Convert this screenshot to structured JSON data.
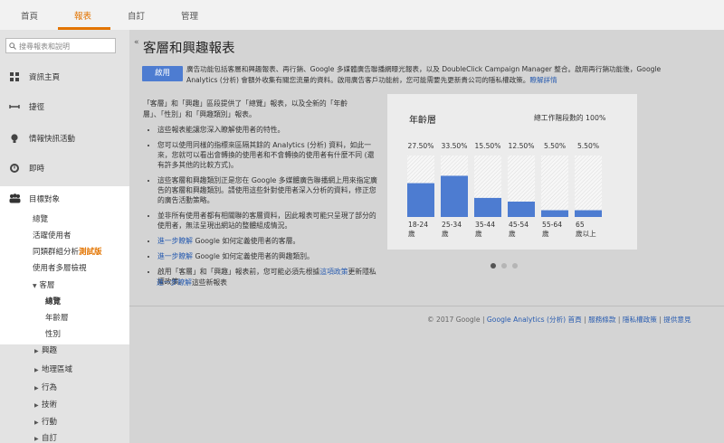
{
  "topnav": {
    "tabs": [
      {
        "label": "首頁"
      },
      {
        "label": "報表"
      },
      {
        "label": "自訂"
      },
      {
        "label": "管理"
      }
    ]
  },
  "sidebar": {
    "search_placeholder": "搜尋報表和說明",
    "items": [
      {
        "label": "資訊主頁"
      },
      {
        "label": "捷徑"
      },
      {
        "label": "情報快訊活動"
      },
      {
        "label": "即時"
      },
      {
        "label": "目標對象"
      }
    ],
    "audience_sub": [
      {
        "label": "總覽"
      },
      {
        "label": "活躍使用者"
      },
      {
        "label": "同類群組分析"
      },
      {
        "label": "使用者多層檢視"
      }
    ],
    "beta": "測試版",
    "demographics": {
      "label": "客層",
      "children": [
        {
          "label": "總覽"
        },
        {
          "label": "年齡層"
        },
        {
          "label": "性別"
        }
      ]
    },
    "tree": [
      {
        "label": "興趣"
      },
      {
        "label": "地理區域"
      },
      {
        "label": "行為"
      },
      {
        "label": "技術"
      },
      {
        "label": "行動"
      },
      {
        "label": "自訂"
      }
    ]
  },
  "main": {
    "title": "客層和興趣報表",
    "enable_button": "啟用",
    "enable_desc": "廣告功能包括客層和興趣報表、再行銷、Google 多媒體廣告聯播網曝光報表，以及 DoubleClick Campaign Manager 整合。啟用再行銷功能後，Google Analytics (分析) 會額外收集有關您流量的資料。啟用廣告客戶功能前，您可能需要先更新貴公司的隱私權政策。",
    "enable_link": "瞭解詳情",
    "intro": "「客層」和「興趣」區段提供了「總覽」報表，以及全新的「年齡層」、「性別」和「興趣類別」報表。",
    "bullets": [
      "這些報表能讓您深入瞭解使用者的特性。",
      "您可以使用同樣的指標來區隔其餘的 Analytics (分析) 資料，如此一來，您就可以看出會轉換的使用者和不會轉換的使用者有什麼不同 (還有許多其他的比較方式)。",
      "這些客層和興趣類別正是您在 Google 多媒體廣告聯播網上用來指定廣告的客層和興趣類別。請使用這些針對使用者深入分析的資料，修正您的廣告活動策略。",
      "並非所有使用者都有相關聯的客層資料，因此報表可能只呈現了部分的使用者，無法呈現出網站的整體組成情況。"
    ],
    "link_rows": [
      {
        "link": "進一步瞭解",
        "text": " Google 如何定義使用者的客層。"
      },
      {
        "link": "進一步瞭解",
        "text": " Google 如何定義使用者的興趣類別。"
      }
    ],
    "policy_before": "啟用「客層」和「興趣」報表前，您可能必須先根據",
    "policy_link": "這項政策",
    "policy_after": "更新隱私權政策。",
    "more_link": "進一步瞭解",
    "more_text": "這些新報表",
    "footer": {
      "copyright": "© 2017 Google | ",
      "links": [
        "Google Analytics (分析) 首頁",
        "服務條款",
        "隱私權政策",
        "提供意見"
      ]
    }
  },
  "colors": {
    "accent": "#e37400",
    "button": "#4d7cd1",
    "bar": "#4d7cd1"
  },
  "chart_data": {
    "type": "bar",
    "title": "年齡層",
    "subtitle": "總工作階段數的 100%",
    "categories": [
      "18-24 歲",
      "25-34 歲",
      "35-44 歲",
      "45-54 歲",
      "55-64 歲",
      "65 歲以上"
    ],
    "value_labels": [
      "27.50%",
      "33.50%",
      "15.50%",
      "12.50%",
      "5.50%",
      "5.50%"
    ],
    "values": [
      27.5,
      33.5,
      15.5,
      12.5,
      5.5,
      5.5
    ],
    "ylim": [
      0,
      100
    ]
  }
}
